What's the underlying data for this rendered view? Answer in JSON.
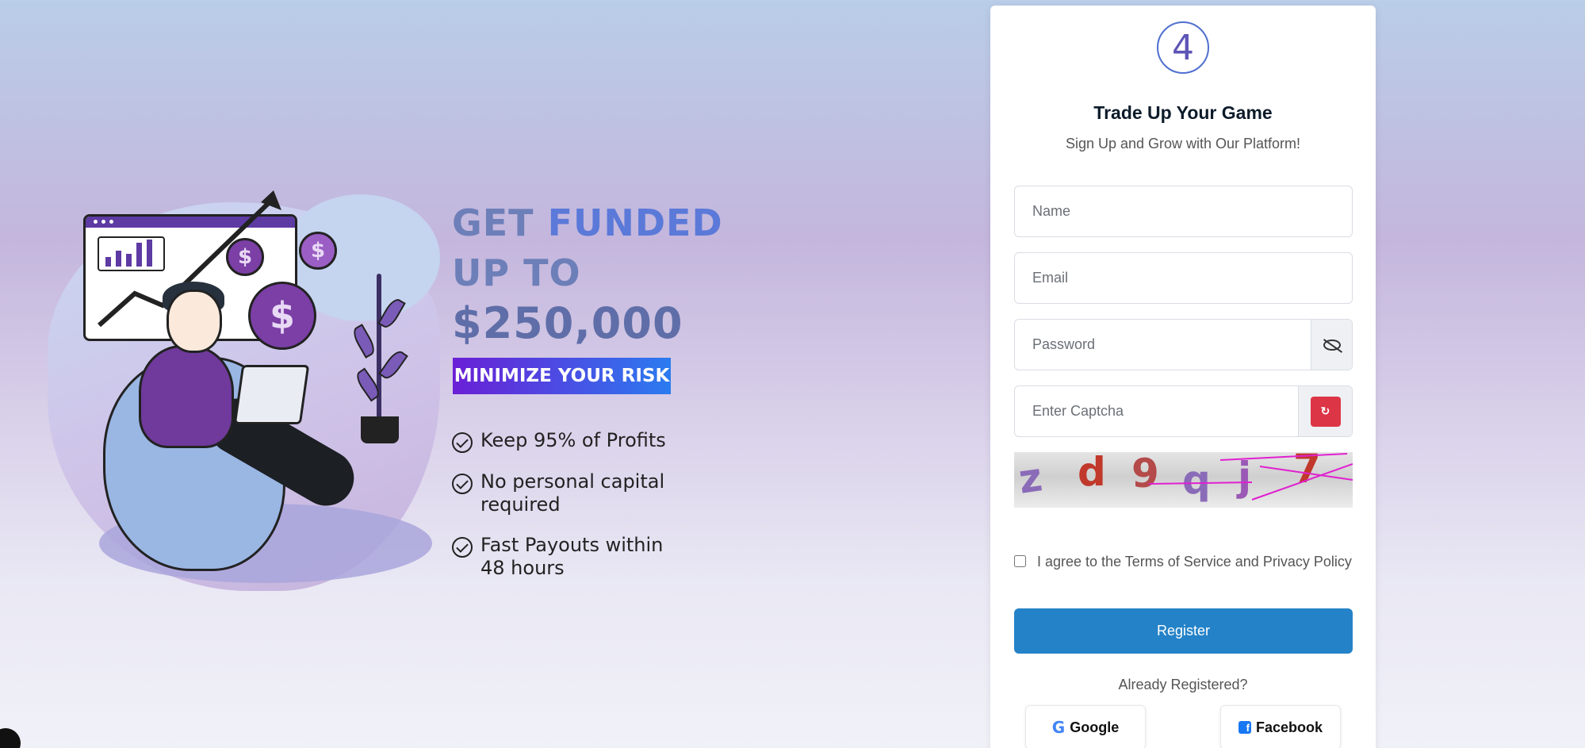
{
  "hero": {
    "headline_line1_a": "GET ",
    "headline_line1_b": "FUNDED",
    "headline_line2": "UP TO",
    "headline_line3": "$250,000",
    "banner": "MINIMIZE YOUR RISK",
    "features": [
      "Keep 95% of Profits",
      "No personal capital required",
      "Fast Payouts within 48 hours"
    ],
    "illustration": {
      "coin_symbol": "$"
    }
  },
  "form": {
    "title": "Trade Up Your Game",
    "subtitle": "Sign Up and Grow with Our Platform!",
    "name_placeholder": "Name",
    "email_placeholder": "Email",
    "password_placeholder": "Password",
    "captcha_placeholder": "Enter Captcha",
    "captcha_text": [
      "z",
      "d",
      "9",
      "q",
      "j",
      "7"
    ],
    "refresh_glyph": "↻",
    "terms": "I agree to the Terms of Service and Privacy Policy",
    "register_label": "Register",
    "already_registered": "Already Registered?",
    "google_label": "Google",
    "facebook_label": "Facebook"
  },
  "icons": {
    "logo": "logo-icon",
    "password_toggle": "eye-slash-icon",
    "captcha_refresh": "refresh-icon",
    "google": "google-icon",
    "facebook": "facebook-icon",
    "feature_check": "check-circle-icon"
  },
  "colors": {
    "register": "#2482c8",
    "refresh": "#dc3545",
    "banner_start": "#6a1fd6",
    "banner_end": "#2b7bf0"
  }
}
